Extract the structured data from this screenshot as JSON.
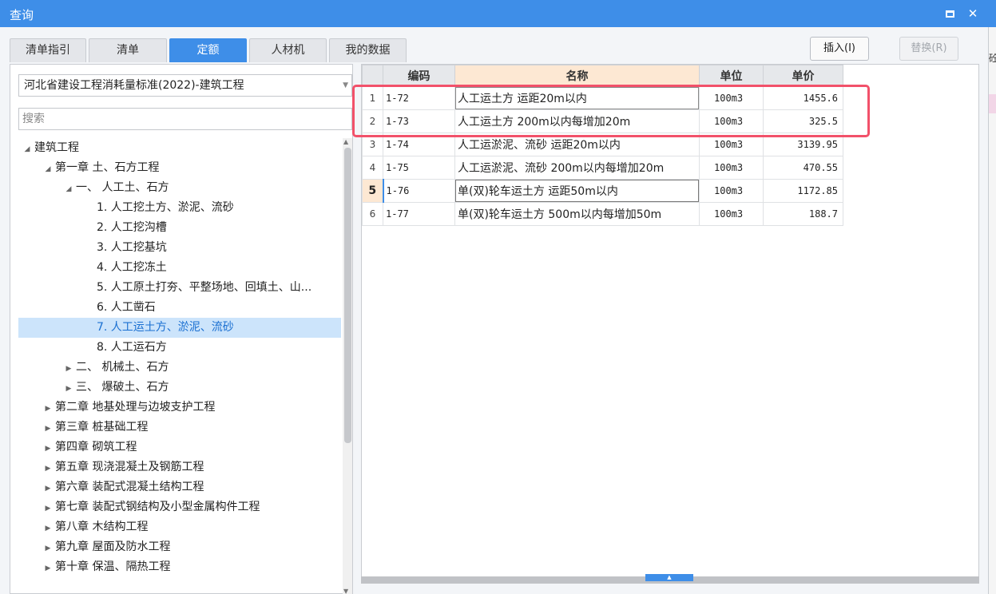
{
  "window": {
    "title": "查询",
    "restore_label": "",
    "close_label": "✕"
  },
  "tabs": [
    {
      "label": "清单指引",
      "active": false
    },
    {
      "label": "清单",
      "active": false
    },
    {
      "label": "定额",
      "active": true
    },
    {
      "label": "人材机",
      "active": false
    },
    {
      "label": "我的数据",
      "active": false
    }
  ],
  "toolbar": {
    "insert_label": "插入(I)",
    "replace_label": "替换(R)"
  },
  "left": {
    "standard": "河北省建设工程消耗量标准(2022)-建筑工程",
    "search_placeholder": "搜索",
    "tree": [
      {
        "label": "建筑工程",
        "level": 0,
        "toggle": "◢",
        "selected": false
      },
      {
        "label": "第一章 土、石方工程",
        "level": 1,
        "toggle": "◢",
        "selected": false
      },
      {
        "label": "一、 人工土、石方",
        "level": 2,
        "toggle": "◢",
        "selected": false
      },
      {
        "label": "1. 人工挖土方、淤泥、流砂",
        "level": 3,
        "toggle": "",
        "selected": false
      },
      {
        "label": "2. 人工挖沟槽",
        "level": 3,
        "toggle": "",
        "selected": false
      },
      {
        "label": "3. 人工挖基坑",
        "level": 3,
        "toggle": "",
        "selected": false
      },
      {
        "label": "4. 人工挖冻土",
        "level": 3,
        "toggle": "",
        "selected": false
      },
      {
        "label": "5. 人工原土打夯、平整场地、回填土、山...",
        "level": 3,
        "toggle": "",
        "selected": false
      },
      {
        "label": "6. 人工凿石",
        "level": 3,
        "toggle": "",
        "selected": false
      },
      {
        "label": "7. 人工运土方、淤泥、流砂",
        "level": 3,
        "toggle": "",
        "selected": true
      },
      {
        "label": "8. 人工运石方",
        "level": 3,
        "toggle": "",
        "selected": false
      },
      {
        "label": "二、 机械土、石方",
        "level": 2,
        "toggle": "▶",
        "selected": false
      },
      {
        "label": "三、 爆破土、石方",
        "level": 2,
        "toggle": "▶",
        "selected": false
      },
      {
        "label": "第二章 地基处理与边坡支护工程",
        "level": 1,
        "toggle": "▶",
        "selected": false
      },
      {
        "label": "第三章 桩基础工程",
        "level": 1,
        "toggle": "▶",
        "selected": false
      },
      {
        "label": "第四章 砌筑工程",
        "level": 1,
        "toggle": "▶",
        "selected": false
      },
      {
        "label": "第五章 现浇混凝土及钢筋工程",
        "level": 1,
        "toggle": "▶",
        "selected": false
      },
      {
        "label": "第六章 装配式混凝土结构工程",
        "level": 1,
        "toggle": "▶",
        "selected": false
      },
      {
        "label": "第七章 装配式钢结构及小型金属构件工程",
        "level": 1,
        "toggle": "▶",
        "selected": false
      },
      {
        "label": "第八章 木结构工程",
        "level": 1,
        "toggle": "▶",
        "selected": false
      },
      {
        "label": "第九章 屋面及防水工程",
        "level": 1,
        "toggle": "▶",
        "selected": false
      },
      {
        "label": "第十章 保温、隔热工程",
        "level": 1,
        "toggle": "▶",
        "selected": false
      }
    ]
  },
  "table": {
    "headers": {
      "code": "编码",
      "name": "名称",
      "unit": "单位",
      "price": "单价"
    },
    "rows": [
      {
        "no": "1",
        "code": "1-72",
        "name": "人工运土方 运距20m以内",
        "unit": "100m3",
        "price": "1455.6"
      },
      {
        "no": "2",
        "code": "1-73",
        "name": "人工运土方 200m以内每增加20m",
        "unit": "100m3",
        "price": "325.5"
      },
      {
        "no": "3",
        "code": "1-74",
        "name": "人工运淤泥、流砂 运距20m以内",
        "unit": "100m3",
        "price": "3139.95"
      },
      {
        "no": "4",
        "code": "1-75",
        "name": "人工运淤泥、流砂 200m以内每增加20m",
        "unit": "100m3",
        "price": "470.55"
      },
      {
        "no": "5",
        "code": "1-76",
        "name": "单(双)轮车运土方 运距50m以内",
        "unit": "100m3",
        "price": "1172.85"
      },
      {
        "no": "6",
        "code": "1-77",
        "name": "单(双)轮车运土方 500m以内每增加50m",
        "unit": "100m3",
        "price": "188.7"
      }
    ],
    "current_row": 5
  },
  "side_strip": {
    "text": "砼"
  },
  "colors": {
    "accent": "#3e8ee8",
    "highlight_box": "#f2516a",
    "selected_tree": "#cce4fb"
  }
}
